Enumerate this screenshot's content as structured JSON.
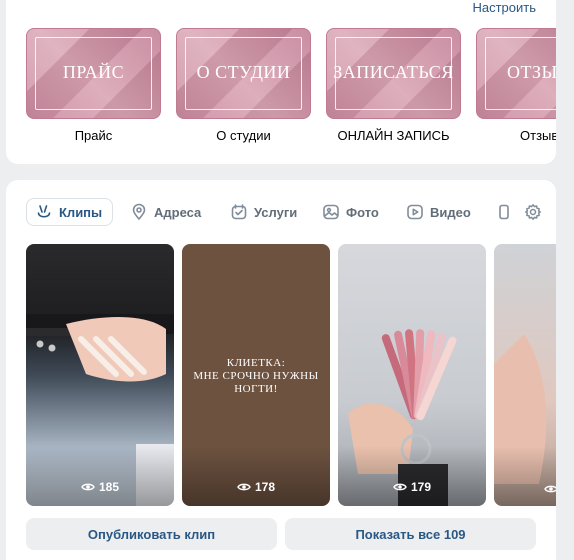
{
  "top_section": {
    "configure_link": "Настроить",
    "tiles": [
      {
        "image_text": "ПРАЙС",
        "caption": "Прайс"
      },
      {
        "image_text": "О СТУДИИ",
        "caption": "О студии"
      },
      {
        "image_text": "ЗАПИСАТЬСЯ",
        "caption": "ОНЛАЙН ЗАПИСЬ"
      },
      {
        "image_text": "ОТЗЫ",
        "caption": "Отзыв"
      }
    ]
  },
  "tabs": [
    {
      "label": "Клипы",
      "icon": "clips-icon",
      "active": true
    },
    {
      "label": "Адреса",
      "icon": "map-pin-icon",
      "active": false
    },
    {
      "label": "Услуги",
      "icon": "services-icon",
      "active": false
    },
    {
      "label": "Фото",
      "icon": "photo-icon",
      "active": false
    },
    {
      "label": "Видео",
      "icon": "video-icon",
      "active": false
    }
  ],
  "clips": [
    {
      "views": "185",
      "overlay_text": ""
    },
    {
      "views": "178",
      "overlay_text": "КЛИЕТКА:\nМНЕ СРОЧНО НУЖНЫ\nНОГТИ!"
    },
    {
      "views": "179",
      "overlay_text": ""
    },
    {
      "views": "",
      "overlay_text": ""
    }
  ],
  "buttons": {
    "publish": "Опубликовать клип",
    "show_all": "Показать все 109"
  },
  "colors": {
    "accent": "#2a5885",
    "tab_text": "#626d7a",
    "page_bg": "#edeef0",
    "tile_pink": "#d19aae",
    "clip2_bg": "#6d5240"
  }
}
